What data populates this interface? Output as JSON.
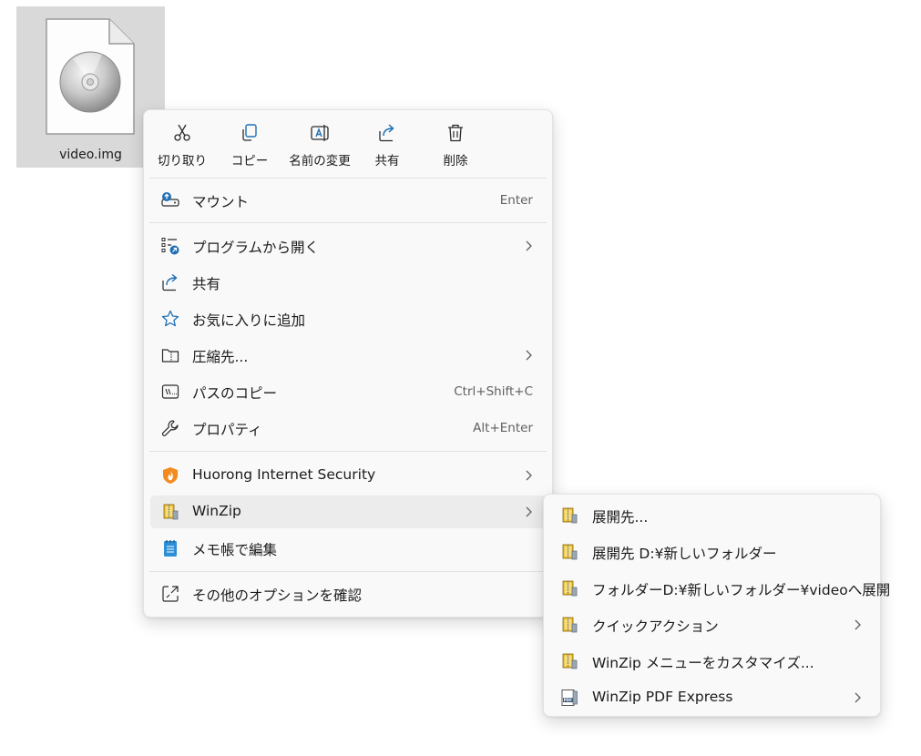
{
  "file": {
    "name": "video.img",
    "icon": "disc-image-icon"
  },
  "toolbar": {
    "cut": "切り取り",
    "copy": "コピー",
    "rename": "名前の変更",
    "share": "共有",
    "delete": "削除"
  },
  "menu": {
    "mount": {
      "label": "マウント",
      "shortcut": "Enter"
    },
    "open_with": {
      "label": "プログラムから開く"
    },
    "share": {
      "label": "共有"
    },
    "favorite": {
      "label": "お気に入りに追加"
    },
    "compress": {
      "label": "圧縮先..."
    },
    "copy_path": {
      "label": "パスのコピー",
      "shortcut": "Ctrl+Shift+C"
    },
    "properties": {
      "label": "プロパティ",
      "shortcut": "Alt+Enter"
    },
    "huorong": {
      "label": "Huorong Internet Security"
    },
    "winzip": {
      "label": "WinZip"
    },
    "notepad": {
      "label": "メモ帳で編集"
    },
    "more": {
      "label": "その他のオプションを確認"
    }
  },
  "winzip_submenu": {
    "extract_to": "展開先...",
    "extract_new_folder": "展開先 D:¥新しいフォルダー",
    "extract_here_video": "フォルダーD:¥新しいフォルダー¥videoへ展開",
    "quick_actions": "クイックアクション",
    "customize": "WinZip メニューをカスタマイズ...",
    "pdf_express": "WinZip PDF Express"
  },
  "colors": {
    "menu_bg": "#f9f9f9",
    "hover_bg": "#ececec",
    "accent_blue": "#1f6fb4",
    "winzip_yellow": "#e8b923",
    "huorong_orange": "#f28a1e"
  }
}
